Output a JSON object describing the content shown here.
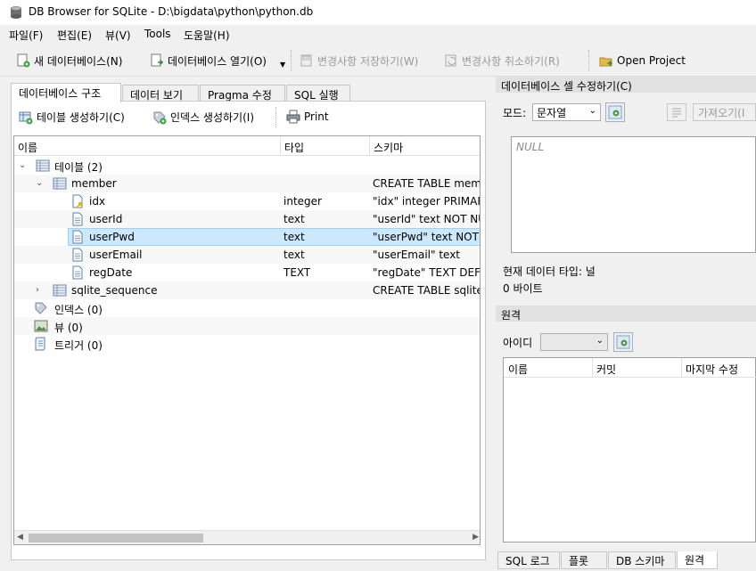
{
  "window": {
    "title": "DB Browser for SQLite - D:\\bigdata\\python\\python.db"
  },
  "menu": [
    "파일(F)",
    "편집(E)",
    "뷰(V)",
    "Tools",
    "도움말(H)"
  ],
  "toolbar": {
    "new_db": "새 데이터베이스(N)",
    "open_db": "데이터베이스 열기(O)",
    "write_changes": "변경사항 저장하기(W)",
    "revert_changes": "변경사항 취소하기(R)",
    "open_project": "Open Project"
  },
  "tabs": [
    "데이터베이스 구조",
    "데이터 보기",
    "Pragma 수정",
    "SQL 실행"
  ],
  "structure_toolbar": {
    "create_table": "테이블 생성하기(C)",
    "create_index": "인덱스 생성하기(I)",
    "print": "Print"
  },
  "tree": {
    "columns": [
      "이름",
      "타입",
      "스키마"
    ],
    "rows": [
      {
        "name": "테이블 (2)",
        "type": "",
        "schema": ""
      },
      {
        "name": "member",
        "type": "",
        "schema": "CREATE TABLE membe"
      },
      {
        "name": "idx",
        "type": "integer",
        "schema": "\"idx\" integer PRIMARY"
      },
      {
        "name": "userId",
        "type": "text",
        "schema": "\"userId\" text NOT NUL"
      },
      {
        "name": "userPwd",
        "type": "text",
        "schema": "\"userPwd\" text NOT N"
      },
      {
        "name": "userEmail",
        "type": "text",
        "schema": "\"userEmail\" text"
      },
      {
        "name": "regDate",
        "type": "TEXT",
        "schema": "\"regDate\" TEXT DEFAU"
      },
      {
        "name": "sqlite_sequence",
        "type": "",
        "schema": "CREATE TABLE sqlite_s"
      },
      {
        "name": "인덱스 (0)",
        "type": "",
        "schema": ""
      },
      {
        "name": "뷰 (0)",
        "type": "",
        "schema": ""
      },
      {
        "name": "트리거 (0)",
        "type": "",
        "schema": ""
      }
    ]
  },
  "cell_editor": {
    "title": "데이터베이스 셀 수정하기(C)",
    "mode_label": "모드:",
    "mode_value": "문자열",
    "import_label": "가져오기(I",
    "null_text": "NULL",
    "type_text": "현재 데이터 타입: 널",
    "size_text": "0 바이트"
  },
  "remote": {
    "title": "원격",
    "identity_label": "아이디",
    "columns": [
      "이름",
      "커밋",
      "마지막 수정"
    ]
  },
  "bottom_tabs": [
    "SQL 로그",
    "플롯",
    "DB 스키마",
    "원격"
  ]
}
